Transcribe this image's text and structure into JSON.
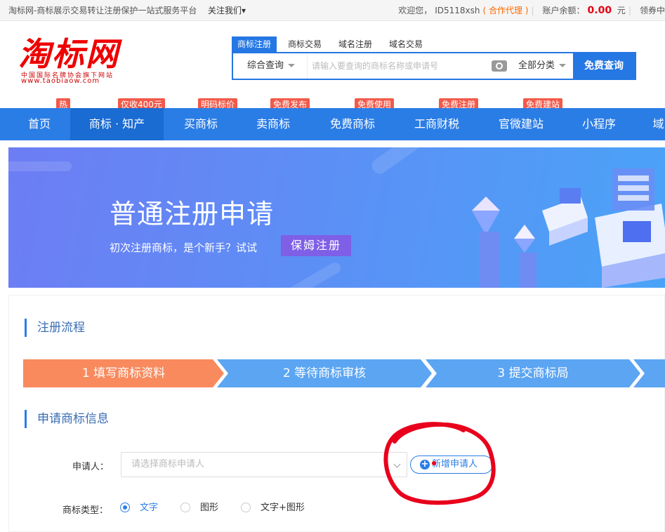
{
  "topbar": {
    "site_desc": "淘标网-商标展示交易转让注册保护一站式服务平台",
    "follow": "关注我们▾",
    "welcome": "欢迎您，",
    "user_id": "ID5118xsh",
    "agent": "( 合作代理 )",
    "balance_label": "账户余额：",
    "balance": "0.00",
    "currency": "元",
    "cut_link": "领券中"
  },
  "logo": {
    "main": "淘标网",
    "sub": "中国国际名牌协会旗下网站",
    "url": "www.taobiaow.com"
  },
  "search": {
    "tabs": [
      "商标注册",
      "商标交易",
      "域名注册",
      "域名交易"
    ],
    "category": "综合查询",
    "placeholder": "请输入要查询的商标名称或申请号",
    "all_category": "全部分类",
    "button": "免费查询"
  },
  "nav": {
    "items": [
      "首页",
      "商标 · 知产",
      "买商标",
      "卖商标",
      "免费商标",
      "工商财税",
      "官微建站",
      "小程序",
      "域"
    ],
    "tags": [
      "热",
      "仅收400元",
      "明码标价",
      "免费发布",
      "免费使用",
      "免费注册",
      "免费建站"
    ]
  },
  "banner": {
    "title": "普通注册申请",
    "subtitle": "初次注册商标，是个新手？试试",
    "button": "保姆注册"
  },
  "process": {
    "title": "注册流程",
    "steps": [
      "1 填写商标资料",
      "2 等待商标审核",
      "3 提交商标局"
    ]
  },
  "form": {
    "title": "申请商标信息",
    "applicant_label": "申请人：",
    "applicant_placeholder": "请选择商标申请人",
    "add_applicant": "新增申请人",
    "type_label": "商标类型：",
    "types": [
      "文字",
      "图形",
      "文字+图形"
    ],
    "selected_type": "文字"
  },
  "colors": {
    "primary": "#2b7de6",
    "accent": "#f88a5e",
    "tag": "#f25a4a",
    "annotation": "#e8001c"
  }
}
